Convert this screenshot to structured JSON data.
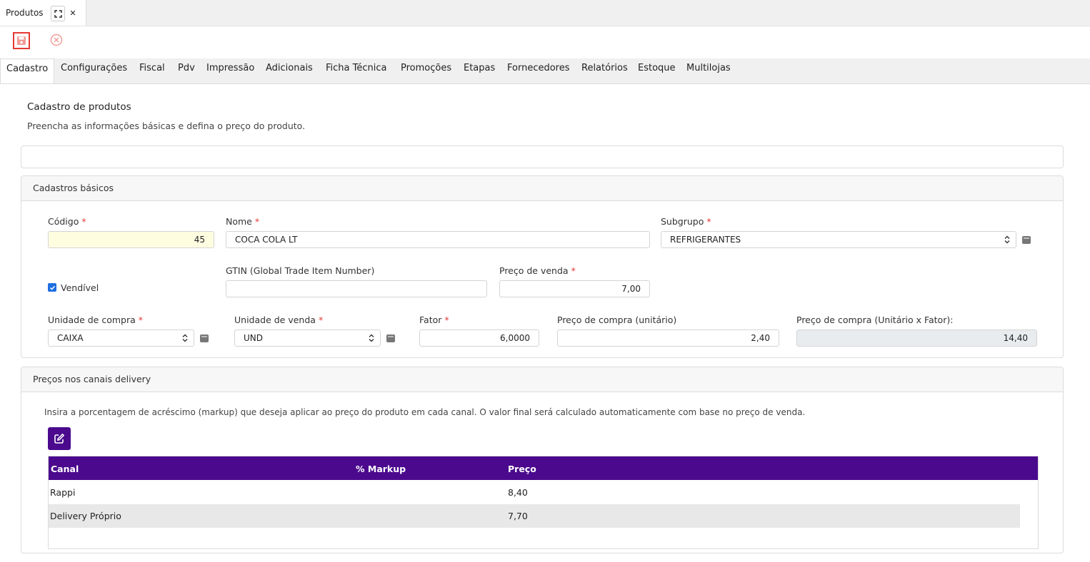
{
  "window_tab": {
    "label": "Produtos",
    "expand_icon": "expand-icon",
    "close_icon": "close-icon",
    "close_glyph": "✕"
  },
  "toolbar": {
    "save_icon": "floppy-disk-icon",
    "cancel_icon": "circle-x-icon"
  },
  "tabs": [
    {
      "label": "Cadastro",
      "active": true
    },
    {
      "label": "Configurações"
    },
    {
      "label": "Fiscal"
    },
    {
      "label": "Pdv"
    },
    {
      "label": "Impressão"
    },
    {
      "label": "Adicionais"
    },
    {
      "label": "Ficha Técnica"
    },
    {
      "label": "Promoções"
    },
    {
      "label": "Etapas"
    },
    {
      "label": "Fornecedores"
    },
    {
      "label": "Relatórios"
    },
    {
      "label": "Estoque"
    },
    {
      "label": "Multilojas"
    }
  ],
  "header": {
    "title": "Cadastro de produtos",
    "subtitle": "Preencha as informações básicas e defina o preço do produto."
  },
  "basic": {
    "section_title": "Cadastros básicos",
    "required_mark": "*",
    "codigo": {
      "label": "Código",
      "value": "45"
    },
    "nome": {
      "label": "Nome",
      "value": "COCA COLA LT"
    },
    "subgrupo": {
      "label": "Subgrupo",
      "value": "REFRIGERANTES"
    },
    "vendivel": {
      "label": "Vendível",
      "checked": true
    },
    "gtin": {
      "label": "GTIN (Global Trade Item Number)",
      "value": ""
    },
    "preco_venda": {
      "label": "Preço de venda",
      "value": "7,00"
    },
    "unidade_compra": {
      "label": "Unidade de compra",
      "value": "CAIXA"
    },
    "unidade_venda": {
      "label": "Unidade de venda",
      "value": "UND"
    },
    "fator": {
      "label": "Fator",
      "value": "6,0000"
    },
    "preco_compra_unit": {
      "label": "Preço de compra (unitário)",
      "value": "2,40"
    },
    "preco_compra_total": {
      "label": "Preço de compra (Unitário x Fator):",
      "value": "14,40"
    }
  },
  "delivery": {
    "section_title": "Preços nos canais delivery",
    "help": "Insira a porcentagem de acréscimo (markup) que deseja aplicar ao preço do produto em cada canal. O valor final será calculado automaticamente com base no preço de venda.",
    "edit_icon": "edit-icon",
    "columns": [
      "Canal",
      "% Markup",
      "Preço"
    ],
    "rows": [
      {
        "canal": "Rappi",
        "markup": "",
        "preco": "8,40"
      },
      {
        "canal": "Delivery Próprio",
        "markup": "",
        "preco": "7,70"
      }
    ]
  },
  "colors": {
    "accent_purple": "#4b0a8d",
    "required_red": "#e53935",
    "check_blue": "#1e6fe0"
  }
}
